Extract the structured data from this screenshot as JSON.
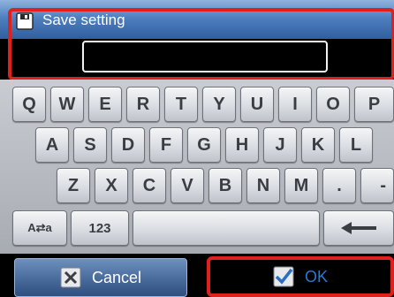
{
  "dialog": {
    "title": "Save setting",
    "title_icon": "floppy-disk-icon"
  },
  "input": {
    "value": "",
    "placeholder": ""
  },
  "keyboard": {
    "row1": [
      "Q",
      "W",
      "E",
      "R",
      "T",
      "Y",
      "U",
      "I",
      "O",
      "P"
    ],
    "row2": [
      "A",
      "S",
      "D",
      "F",
      "G",
      "H",
      "J",
      "K",
      "L"
    ],
    "row3": [
      "Z",
      "X",
      "C",
      "V",
      "B",
      "N",
      "M",
      ".",
      " -"
    ],
    "case_toggle": "A⇄a",
    "numbers": "123",
    "backspace_icon": "left-arrow-icon"
  },
  "buttons": {
    "cancel": "Cancel",
    "ok": "OK",
    "cancel_icon": "close-icon",
    "ok_icon": "checkmark-icon"
  },
  "colors": {
    "title_bar": "#4f7fbf",
    "highlight_frame": "#e0201c",
    "ok_text": "#2a78d4"
  }
}
